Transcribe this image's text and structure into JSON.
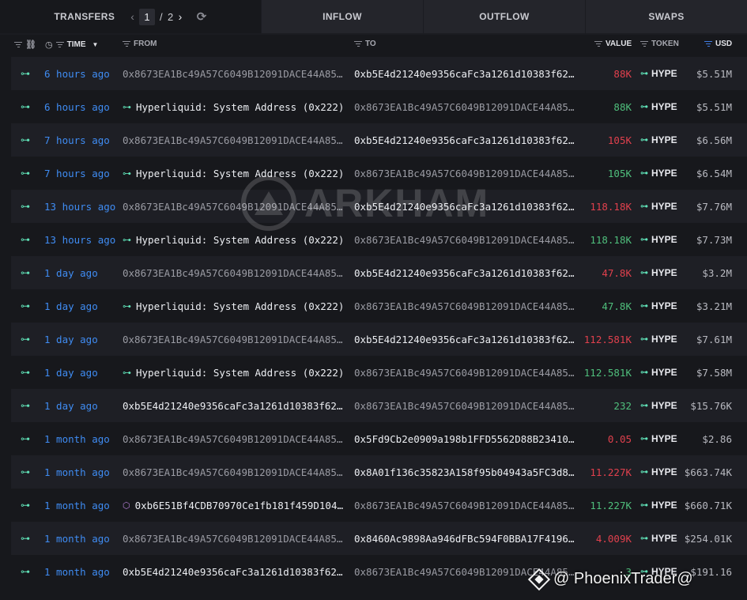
{
  "tabs": {
    "transfers": "TRANSFERS",
    "page_current": "1",
    "page_sep": "/",
    "page_total": "2",
    "inflow": "INFLOW",
    "outflow": "OUTFLOW",
    "swaps": "SWAPS"
  },
  "columns": {
    "time": "TIME",
    "from": "FROM",
    "to": "TO",
    "value": "VALUE",
    "token": "TOKEN",
    "usd": "USD"
  },
  "rows": [
    {
      "time": "6 hours ago",
      "from": "0x8673EA1Bc49A57C6049B12091DACE44A85E…",
      "from_entity": false,
      "to": "0xb5E4d21240e9356caFc3a1261d10383f62D…",
      "to_bright": true,
      "value": "88K",
      "dir": "out",
      "token": "HYPE",
      "usd": "$5.51M"
    },
    {
      "time": "6 hours ago",
      "from": "Hyperliquid: System Address (0x222)",
      "from_entity": true,
      "to": "0x8673EA1Bc49A57C6049B12091DACE44A85E…",
      "to_bright": false,
      "value": "88K",
      "dir": "in",
      "token": "HYPE",
      "usd": "$5.51M"
    },
    {
      "time": "7 hours ago",
      "from": "0x8673EA1Bc49A57C6049B12091DACE44A85E…",
      "from_entity": false,
      "to": "0xb5E4d21240e9356caFc3a1261d10383f62D…",
      "to_bright": true,
      "value": "105K",
      "dir": "out",
      "token": "HYPE",
      "usd": "$6.56M"
    },
    {
      "time": "7 hours ago",
      "from": "Hyperliquid: System Address (0x222)",
      "from_entity": true,
      "to": "0x8673EA1Bc49A57C6049B12091DACE44A85E…",
      "to_bright": false,
      "value": "105K",
      "dir": "in",
      "token": "HYPE",
      "usd": "$6.54M"
    },
    {
      "time": "13 hours ago",
      "from": "0x8673EA1Bc49A57C6049B12091DACE44A85E…",
      "from_entity": false,
      "to": "0xb5E4d21240e9356caFc3a1261d10383f62D…",
      "to_bright": true,
      "value": "118.18K",
      "dir": "out",
      "token": "HYPE",
      "usd": "$7.76M"
    },
    {
      "time": "13 hours ago",
      "from": "Hyperliquid: System Address (0x222)",
      "from_entity": true,
      "to": "0x8673EA1Bc49A57C6049B12091DACE44A85E…",
      "to_bright": false,
      "value": "118.18K",
      "dir": "in",
      "token": "HYPE",
      "usd": "$7.73M"
    },
    {
      "time": "1 day ago",
      "from": "0x8673EA1Bc49A57C6049B12091DACE44A85E…",
      "from_entity": false,
      "to": "0xb5E4d21240e9356caFc3a1261d10383f62D…",
      "to_bright": true,
      "value": "47.8K",
      "dir": "out",
      "token": "HYPE",
      "usd": "$3.2M"
    },
    {
      "time": "1 day ago",
      "from": "Hyperliquid: System Address (0x222)",
      "from_entity": true,
      "to": "0x8673EA1Bc49A57C6049B12091DACE44A85E…",
      "to_bright": false,
      "value": "47.8K",
      "dir": "in",
      "token": "HYPE",
      "usd": "$3.21M"
    },
    {
      "time": "1 day ago",
      "from": "0x8673EA1Bc49A57C6049B12091DACE44A85E…",
      "from_entity": false,
      "to": "0xb5E4d21240e9356caFc3a1261d10383f62D…",
      "to_bright": true,
      "value": "112.581K",
      "dir": "out",
      "token": "HYPE",
      "usd": "$7.61M"
    },
    {
      "time": "1 day ago",
      "from": "Hyperliquid: System Address (0x222)",
      "from_entity": true,
      "to": "0x8673EA1Bc49A57C6049B12091DACE44A85E…",
      "to_bright": false,
      "value": "112.581K",
      "dir": "in",
      "token": "HYPE",
      "usd": "$7.58M"
    },
    {
      "time": "1 day ago",
      "from": "0xb5E4d21240e9356caFc3a1261d10383f62D…",
      "from_entity": false,
      "from_bright": true,
      "to": "0x8673EA1Bc49A57C6049B12091DACE44A85E…",
      "to_bright": false,
      "value": "232",
      "dir": "in",
      "token": "HYPE",
      "usd": "$15.76K"
    },
    {
      "time": "1 month ago",
      "from": "0x8673EA1Bc49A57C6049B12091DACE44A85E…",
      "from_entity": false,
      "to": "0x5Fd9Cb2e0909a198b1FFD5562D88B234100…",
      "to_bright": true,
      "value": "0.05",
      "dir": "out",
      "token": "HYPE",
      "usd": "$2.86"
    },
    {
      "time": "1 month ago",
      "from": "0x8673EA1Bc49A57C6049B12091DACE44A85E…",
      "from_entity": false,
      "to": "0x8A01f136c35823A158f95b04943a5FC3d8f…",
      "to_bright": true,
      "value": "11.227K",
      "dir": "out",
      "token": "HYPE",
      "usd": "$663.74K"
    },
    {
      "time": "1 month ago",
      "from": "0xb6E51Bf4CDB70970Ce1fb181f459D104…",
      "from_entity": false,
      "from_bright": true,
      "from_icon": true,
      "to": "0x8673EA1Bc49A57C6049B12091DACE44A85E…",
      "to_bright": false,
      "value": "11.227K",
      "dir": "in",
      "token": "HYPE",
      "usd": "$660.71K"
    },
    {
      "time": "1 month ago",
      "from": "0x8673EA1Bc49A57C6049B12091DACE44A85E…",
      "from_entity": false,
      "to": "0x8460Ac9898Aa946dFBc594F0BBA17F4196c…",
      "to_bright": true,
      "value": "4.009K",
      "dir": "out",
      "token": "HYPE",
      "usd": "$254.01K"
    },
    {
      "time": "1 month ago",
      "from": "0xb5E4d21240e9356caFc3a1261d10383f62D…",
      "from_entity": false,
      "from_bright": true,
      "to": "0x8673EA1Bc49A57C6049B12091DACE44A85E…",
      "to_bright": false,
      "value": "3",
      "dir": "in",
      "token": "HYPE",
      "usd": "$191.16"
    }
  ],
  "watermark": "ARKHAM",
  "credit": "@ PhoenixTrader@"
}
